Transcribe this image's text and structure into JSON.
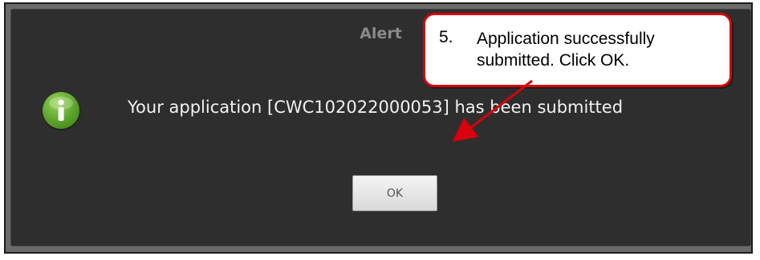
{
  "dialog": {
    "title": "Alert",
    "message": "Your application [CWC102022000053] has been submitted",
    "ok_label": "OK",
    "icon": "info-icon"
  },
  "callout": {
    "step": "5.",
    "text": "Application successfully submitted. Click OK.",
    "border_color": "#d8000c"
  },
  "colors": {
    "dialog_background": "#2e2e2e",
    "icon_green": "#5aa22a",
    "arrow": "#d8000c"
  }
}
